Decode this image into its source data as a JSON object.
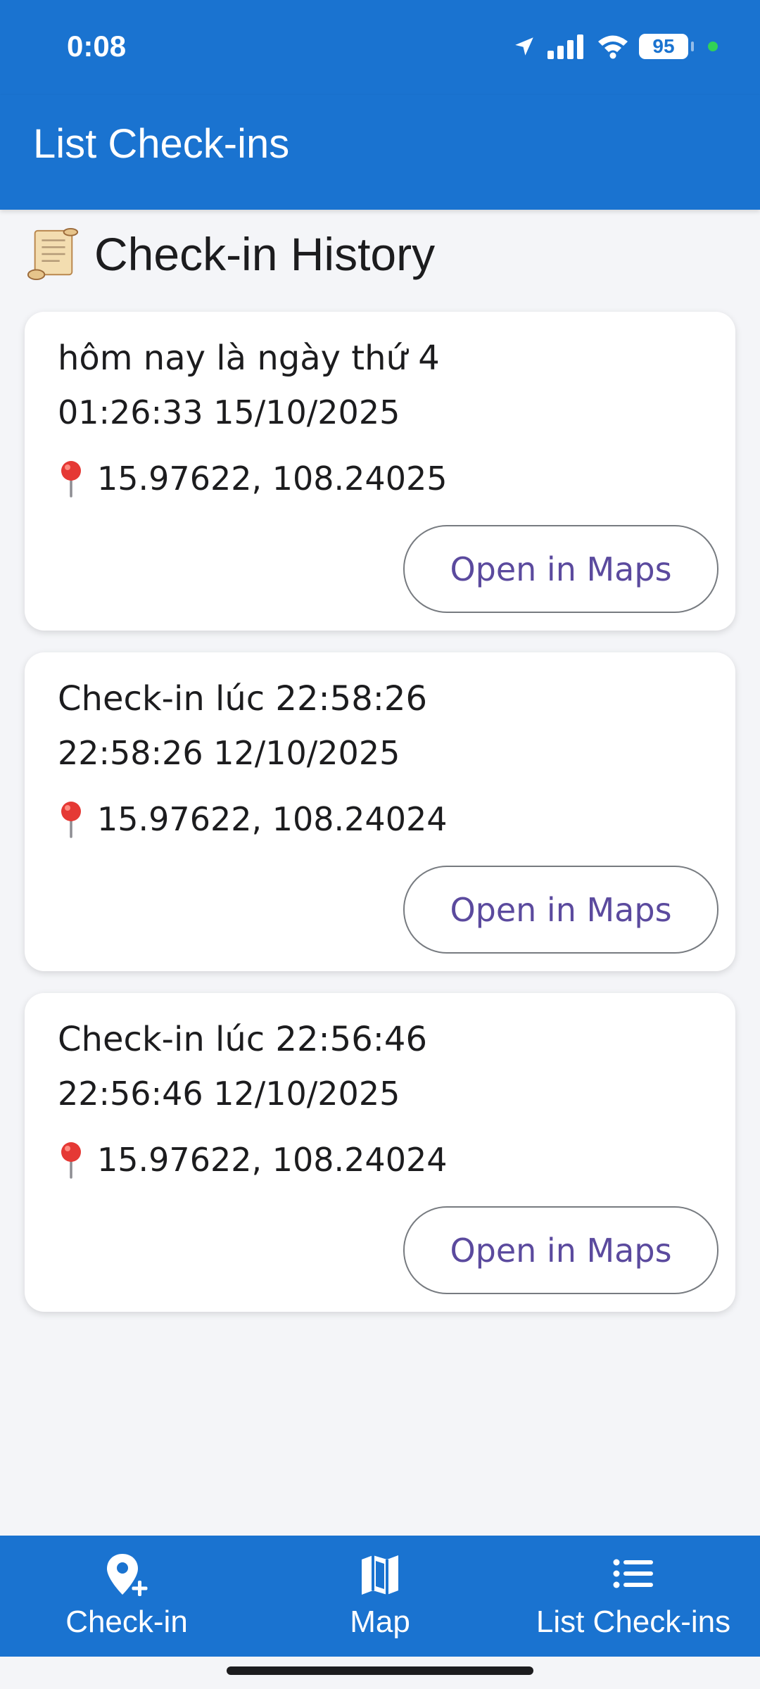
{
  "status_bar": {
    "time": "0:08",
    "battery": "95"
  },
  "app_bar": {
    "title": "List Check-ins"
  },
  "section": {
    "heading": "Check-in History",
    "icon": "scroll-icon"
  },
  "checkins": [
    {
      "title": "hôm nay là ngày thứ 4",
      "datetime": "01:26:33 15/10/2025",
      "coords": "15.97622, 108.24025",
      "button_label": "Open in Maps"
    },
    {
      "title": "Check-in lúc 22:58:26",
      "datetime": "22:58:26 12/10/2025",
      "coords": "15.97622, 108.24024",
      "button_label": "Open in Maps"
    },
    {
      "title": "Check-in lúc 22:56:46",
      "datetime": "22:56:46 12/10/2025",
      "coords": "15.97622, 108.24024",
      "button_label": "Open in Maps"
    }
  ],
  "bottom_nav": {
    "items": [
      {
        "label": "Check-in",
        "icon": "add-location-icon"
      },
      {
        "label": "Map",
        "icon": "map-icon"
      },
      {
        "label": "List Check-ins",
        "icon": "list-icon"
      }
    ],
    "active": "List Check-ins"
  },
  "colors": {
    "primary": "#1a73d0",
    "background": "#f4f5f8",
    "button_text": "#5b4a9e"
  }
}
